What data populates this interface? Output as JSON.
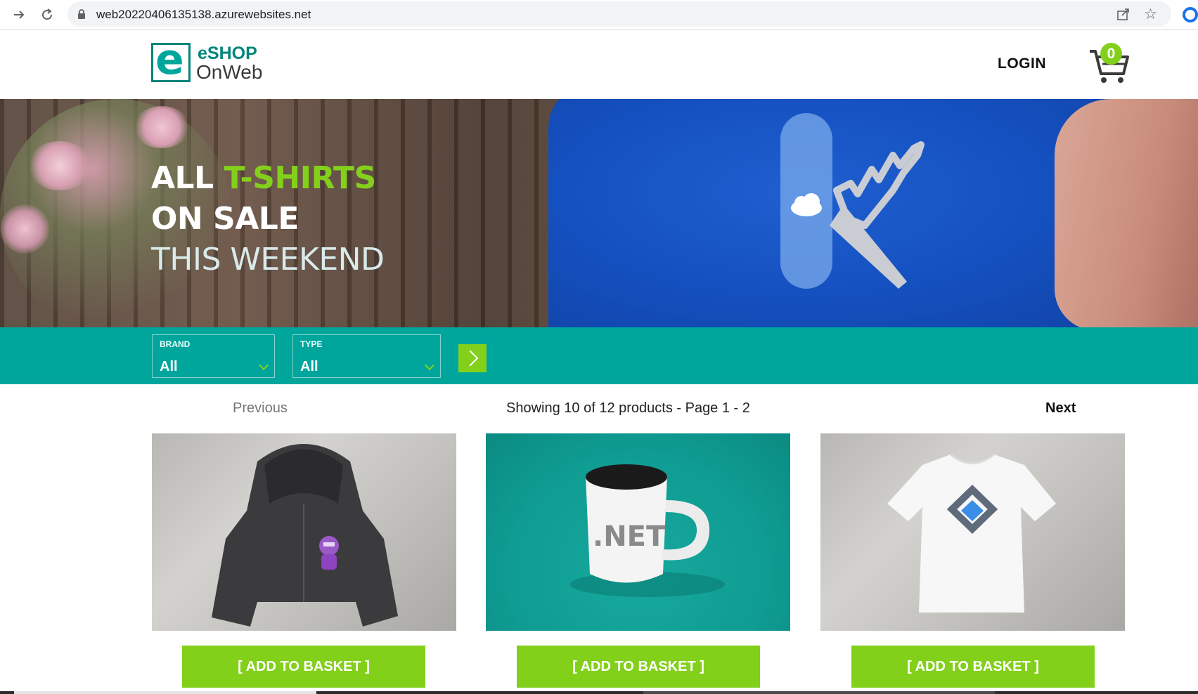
{
  "browser": {
    "url": "web20220406135138.azurewebsites.net",
    "back_icon": "arrow-right-icon",
    "reload_icon": "reload-icon"
  },
  "header": {
    "logo_letter": "e",
    "logo_line1": "eSHOP",
    "logo_line2": "OnWeb",
    "login_label": "LOGIN",
    "cart_count": "0"
  },
  "hero": {
    "line1_a": "ALL ",
    "line1_b": "T-SHIRTS",
    "line2": "ON SALE",
    "line3": "THIS WEEKEND"
  },
  "filters": {
    "brand": {
      "label": "BRAND",
      "value": "All"
    },
    "type": {
      "label": "TYPE",
      "value": "All"
    }
  },
  "pager": {
    "previous": "Previous",
    "info": "Showing 10 of 12 products - Page 1 - 2",
    "next": "Next"
  },
  "products": [
    {
      "image": "hoodie-photo",
      "button": "[ ADD TO BASKET ]"
    },
    {
      "image": "net-mug-photo",
      "mug_text": ".NET",
      "button": "[ ADD TO BASKET ]"
    },
    {
      "image": "white-tshirt-photo",
      "button": "[ ADD TO BASKET ]"
    }
  ],
  "colors": {
    "accent_green": "#83d01b",
    "teal": "#00a69c",
    "dark_teal": "#00857a"
  }
}
